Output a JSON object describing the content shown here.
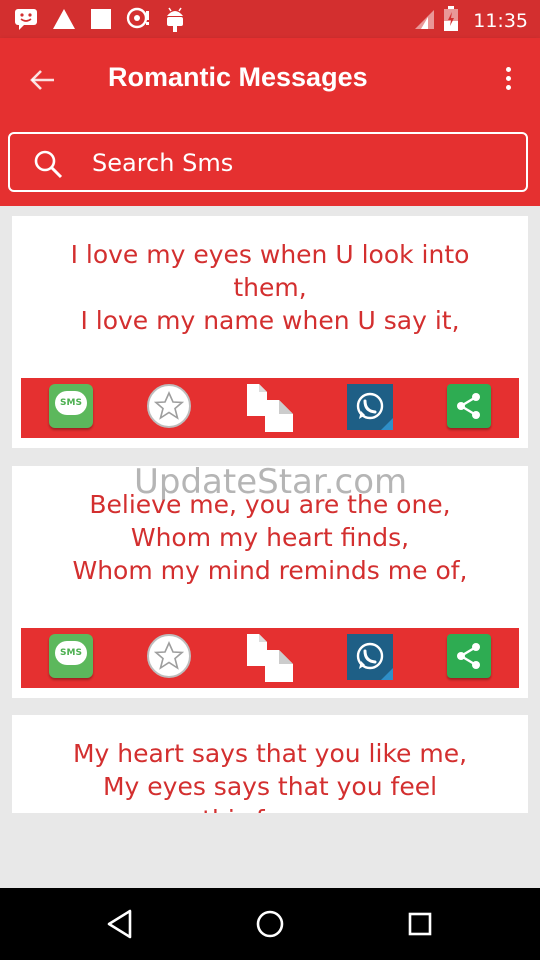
{
  "status_bar": {
    "time": "11:35",
    "left_icons": [
      "emoji-notification-icon",
      "warning-icon",
      "square-icon",
      "location-icon",
      "android-icon"
    ],
    "right_icons": [
      "signal-icon",
      "battery-icon"
    ]
  },
  "app_bar": {
    "title": "Romantic Messages",
    "back_icon": "arrow-back-icon",
    "menu_icon": "more-vert-icon"
  },
  "search": {
    "placeholder": "Search Sms",
    "value": ""
  },
  "messages": [
    {
      "text": "I love my eyes when U look into them,\nI love my name when U say it,"
    },
    {
      "text": "Believe me, you are the one,\nWhom my heart finds,\nWhom my mind reminds me of,"
    },
    {
      "text": "My heart says that you like me,\nMy eyes says that you feel\nthis for me"
    }
  ],
  "actions": {
    "sms_label": "SMS",
    "icons": [
      "sms-icon",
      "star-icon",
      "copy-icon",
      "whatsapp-icon",
      "share-icon"
    ]
  },
  "watermark": "UpdateStar.com",
  "colors": {
    "primary": "#e53030",
    "status_bar": "#d32f2f",
    "message_text": "#d32f2f",
    "sms_green": "#5cb85c",
    "whatsapp_blue": "#1e5f86",
    "share_green": "#2eac52"
  }
}
